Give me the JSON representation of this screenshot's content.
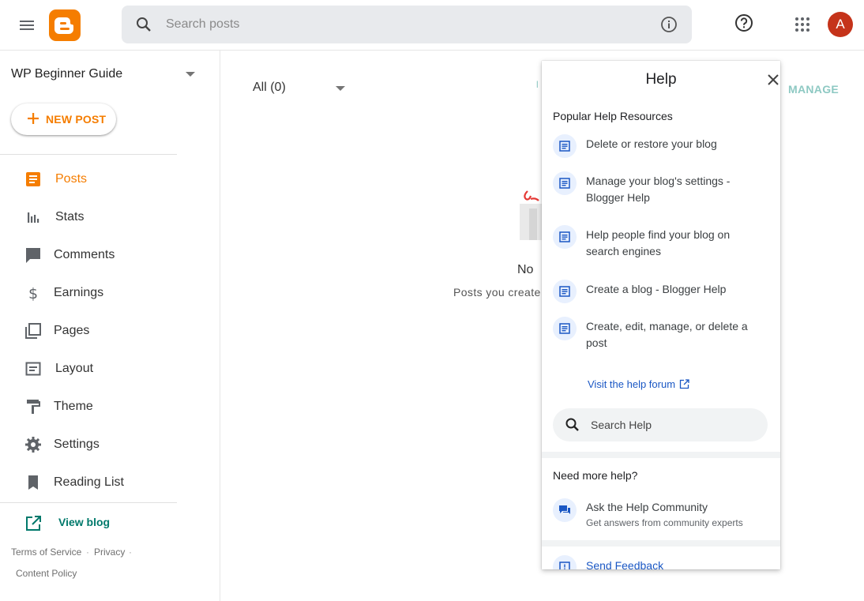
{
  "header": {
    "search_placeholder": "Search posts",
    "avatar_initial": "A"
  },
  "sidebar": {
    "blog_name": "WP Beginner Guide",
    "new_post_label": "NEW POST",
    "items": [
      {
        "label": "Posts",
        "icon": "posts-icon",
        "active": true
      },
      {
        "label": "Stats",
        "icon": "stats-icon"
      },
      {
        "label": "Comments",
        "icon": "comments-icon"
      },
      {
        "label": "Earnings",
        "icon": "dollar-icon"
      },
      {
        "label": "Pages",
        "icon": "pages-icon"
      },
      {
        "label": "Layout",
        "icon": "layout-icon"
      },
      {
        "label": "Theme",
        "icon": "paint-roller-icon"
      },
      {
        "label": "Settings",
        "icon": "gear-icon"
      },
      {
        "label": "Reading List",
        "icon": "bookmark-icon"
      }
    ],
    "view_blog_label": "View blog",
    "footer": {
      "terms": "Terms of Service",
      "privacy": "Privacy",
      "content_policy": "Content Policy"
    }
  },
  "main": {
    "filter_label": "All (0)",
    "manage_label": "MANAGE",
    "obscured_label_fragment": "l",
    "empty_title_fragment": "No",
    "empty_subtitle_fragment": "Posts you create"
  },
  "help_panel": {
    "title": "Help",
    "popular_heading": "Popular Help Resources",
    "resources": [
      "Delete or restore your blog",
      "Manage your blog's settings - Blogger Help",
      "Help people find your blog on search engines",
      "Create a blog - Blogger Help",
      "Create, edit, manage, or delete a post"
    ],
    "forum_link": "Visit the help forum",
    "search_placeholder": "Search Help",
    "more_help_heading": "Need more help?",
    "community_title": "Ask the Help Community",
    "community_subtitle": "Get answers from community experts",
    "feedback_label": "Send Feedback"
  },
  "colors": {
    "brand_orange": "#f57d00",
    "teal": "#00796b",
    "link_blue": "#1a57c4",
    "avatar_red": "#c5331a"
  }
}
